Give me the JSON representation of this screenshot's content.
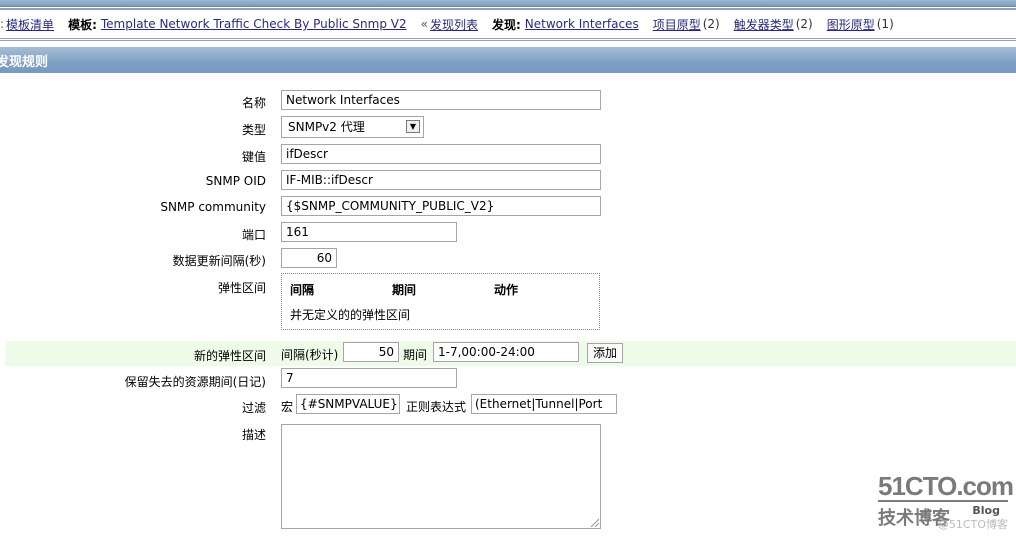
{
  "breadcrumb": {
    "template_list_link": "模板清单",
    "template_label": "模板:",
    "template_link": "Template Network Traffic Check By Public Snmp V2",
    "discovery_list_sep": "«",
    "discovery_list_link": "发现列表",
    "discovery_label": "发现:",
    "discovery_link": "Network Interfaces",
    "item_prototypes_link": "项目原型",
    "item_prototypes_count": "(2)",
    "trigger_types_link": "触发器类型",
    "trigger_types_count": "(2)",
    "graph_prototypes_link": "图形原型",
    "graph_prototypes_count": "(1)"
  },
  "section": {
    "title": "发现规则"
  },
  "form": {
    "name": {
      "label": "名称",
      "value": "Network Interfaces"
    },
    "type": {
      "label": "类型",
      "value": "SNMPv2 代理"
    },
    "key": {
      "label": "键值",
      "value": "ifDescr"
    },
    "snmp_oid": {
      "label": "SNMP OID",
      "value": "IF-MIB::ifDescr"
    },
    "snmp_community": {
      "label": "SNMP community",
      "value": "{$SNMP_COMMUNITY_PUBLIC_V2}"
    },
    "port": {
      "label": "端口",
      "value": "161"
    },
    "update_interval": {
      "label": "数据更新间隔(秒)",
      "value": "60"
    },
    "flexible_intervals": {
      "label": "弹性区间",
      "columns": [
        "间隔",
        "期间",
        "动作"
      ],
      "empty_text": "并无定义的的弹性区间"
    },
    "new_flexible_interval": {
      "label": "新的弹性区间",
      "interval_label": "间隔(秒计)",
      "interval_value": "50",
      "period_label": "期间",
      "period_value": "1-7,00:00-24:00",
      "add_button": "添加"
    },
    "keep_lost_resources": {
      "label": "保留失去的资源期间(日记)",
      "value": "7"
    },
    "filter": {
      "label": "过滤",
      "macro_label": "宏",
      "macro_value": "{#SNMPVALUE}",
      "regex_label": "正则表达式",
      "regex_value": "(Ethernet|Tunnel|Port"
    },
    "description": {
      "label": "描述",
      "value": ""
    }
  },
  "watermark": {
    "site": "51CTO.com",
    "subtitle": "技术博客",
    "blog": "Blog",
    "faint": "@51CTO博客"
  }
}
